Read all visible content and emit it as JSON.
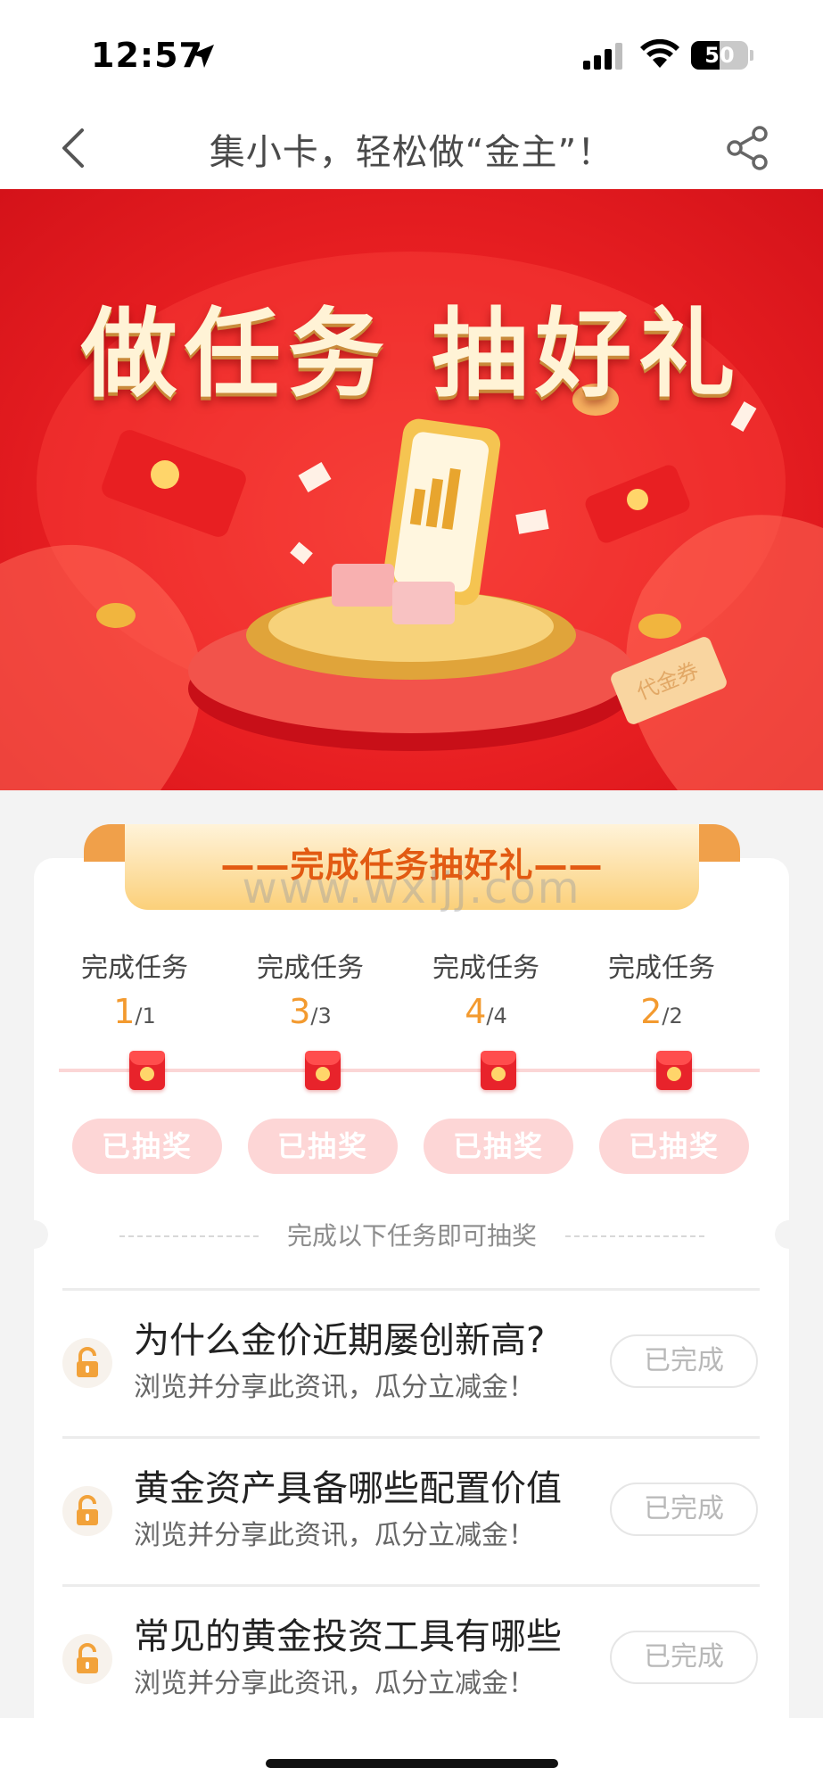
{
  "status_bar": {
    "time": "12:57",
    "battery_level": 50,
    "battery_text": "50",
    "icons": [
      "location-arrow-icon",
      "cellular-signal-icon",
      "wifi-icon",
      "battery-icon"
    ]
  },
  "nav": {
    "title": "集小卡，轻松做“金主”！",
    "back_icon": "chevron-left-icon",
    "share_icon": "share-icon"
  },
  "banner": {
    "title": "做任务 抽好礼",
    "small_text": "代金券"
  },
  "task_section": {
    "ribbon_title": "——完成任务抽好礼——",
    "watermark": "www.wxljj.com",
    "progress": [
      {
        "label": "完成任务",
        "done": "1",
        "total": "/1",
        "button": "已抽奖"
      },
      {
        "label": "完成任务",
        "done": "3",
        "total": "/3",
        "button": "已抽奖"
      },
      {
        "label": "完成任务",
        "done": "4",
        "total": "/4",
        "button": "已抽奖"
      },
      {
        "label": "完成任务",
        "done": "2",
        "total": "/2",
        "button": "已抽奖"
      }
    ],
    "divider_text": "完成以下任务即可抽奖",
    "tasks": [
      {
        "title": "为什么金价近期屡创新高?",
        "subtitle": "浏览并分享此资讯，瓜分立减金！",
        "status": "已完成"
      },
      {
        "title": "黄金资产具备哪些配置价值",
        "subtitle": "浏览并分享此资讯，瓜分立减金！",
        "status": "已完成"
      },
      {
        "title": "常见的黄金投资工具有哪些",
        "subtitle": "浏览并分享此资讯，瓜分立减金！",
        "status": "已完成"
      }
    ]
  },
  "colors": {
    "accent_orange": "#f39a2f",
    "banner_red": "#e81f22",
    "draw_button_pink": "#fdd6d6",
    "ribbon_gold": "#fbd07a"
  }
}
